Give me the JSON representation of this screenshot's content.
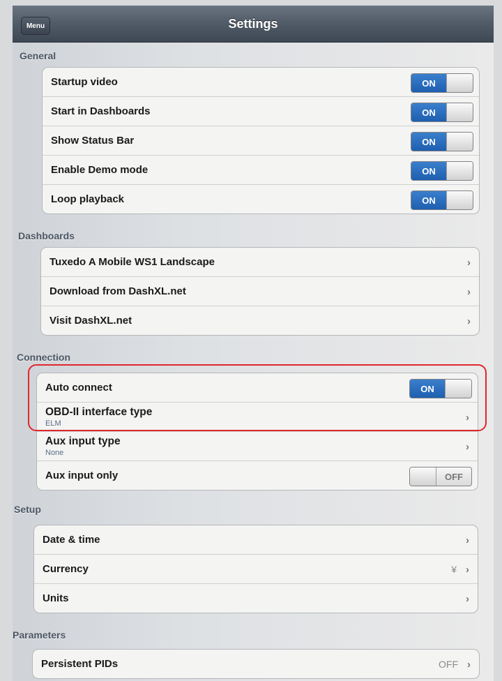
{
  "navbar": {
    "menu_label": "Menu",
    "title": "Settings"
  },
  "sections": {
    "general": {
      "header": "General",
      "rows": [
        {
          "label": "Startup video",
          "toggle": "ON"
        },
        {
          "label": "Start in Dashboards",
          "toggle": "ON"
        },
        {
          "label": "Show Status Bar",
          "toggle": "ON"
        },
        {
          "label": "Enable Demo mode",
          "toggle": "ON"
        },
        {
          "label": "Loop playback",
          "toggle": "ON"
        }
      ]
    },
    "dashboards": {
      "header": "Dashboards",
      "rows": [
        {
          "label": "Tuxedo A Mobile WS1 Landscape"
        },
        {
          "label": "Download from DashXL.net"
        },
        {
          "label": "Visit DashXL.net"
        }
      ]
    },
    "connection": {
      "header": "Connection",
      "rows": [
        {
          "label": "Auto connect",
          "toggle": "ON"
        },
        {
          "label": "OBD-II interface type",
          "sub": "ELM"
        },
        {
          "label": "Aux input type",
          "sub": "None"
        },
        {
          "label": "Aux input only",
          "toggle": "OFF"
        }
      ]
    },
    "setup": {
      "header": "Setup",
      "rows": [
        {
          "label": "Date & time"
        },
        {
          "label": "Currency",
          "detail": "¥"
        },
        {
          "label": "Units"
        }
      ]
    },
    "parameters": {
      "header": "Parameters",
      "rows": [
        {
          "label": "Persistent PIDs",
          "detail": "OFF"
        }
      ]
    }
  },
  "colors": {
    "toggle_on": "#2a6fc0",
    "highlight": "#e1262c",
    "navbar": "#505b68"
  }
}
